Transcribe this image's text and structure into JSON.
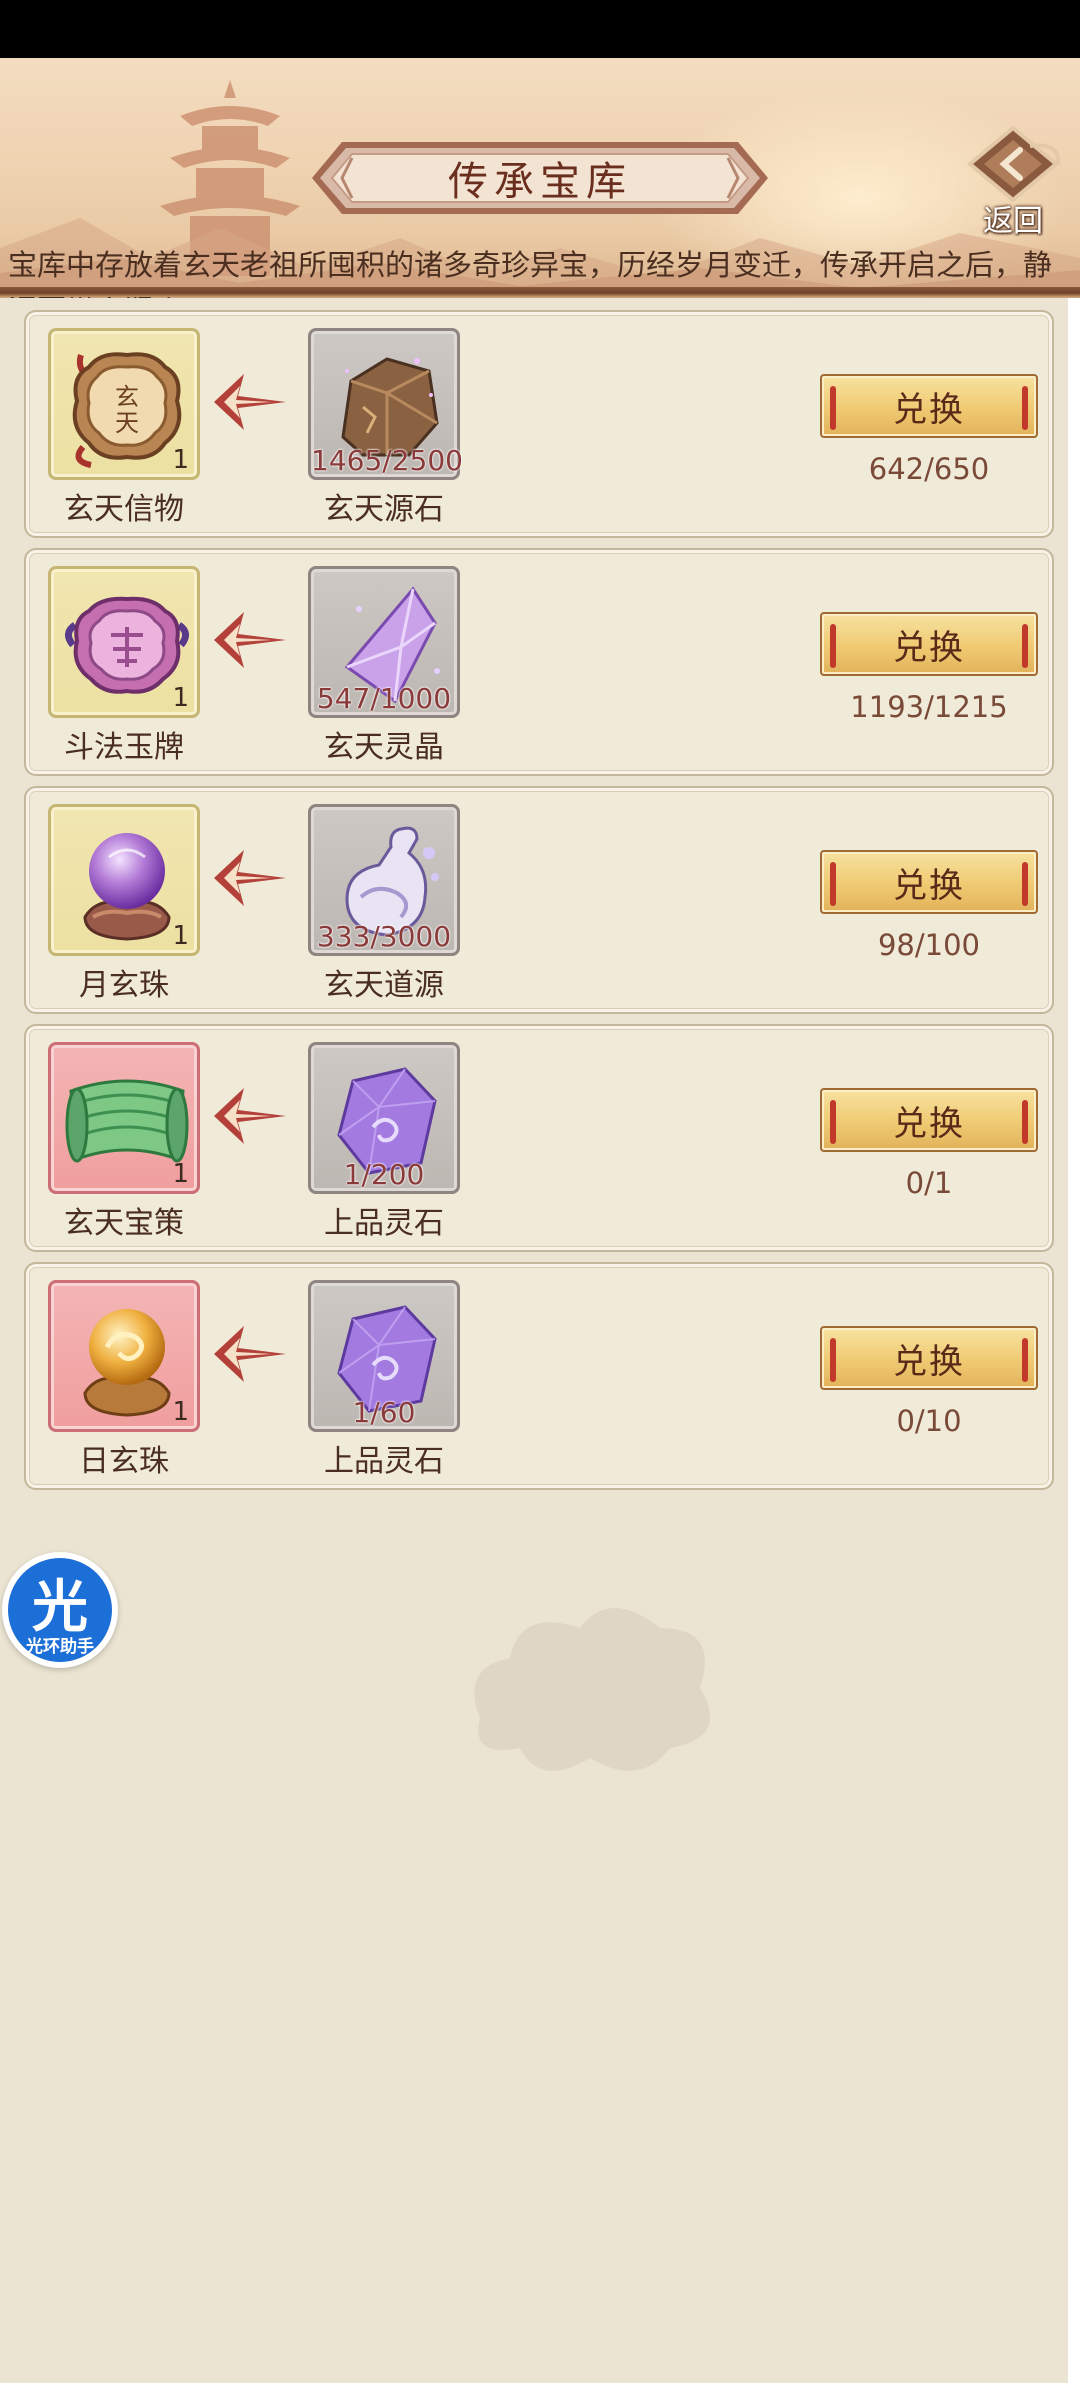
{
  "header": {
    "title": "传承宝库",
    "back_label": "返回",
    "description": "宝库中存放着玄天老祖所囤积的诸多奇珍异宝，历经岁月变迁，传承开启之后，静待有缘人取之。"
  },
  "exchange_items": [
    {
      "reward_name": "玄天信物",
      "reward_count": "1",
      "reward_icon": "token-plaque-icon",
      "reward_frame": "gold",
      "cost_name": "玄天源石",
      "cost_progress": "1465/2500",
      "cost_icon": "source-stone-icon",
      "button_label": "兑换",
      "limit": "642/650"
    },
    {
      "reward_name": "斗法玉牌",
      "reward_count": "1",
      "reward_icon": "jade-tablet-icon",
      "reward_frame": "gold",
      "cost_name": "玄天灵晶",
      "cost_progress": "547/1000",
      "cost_icon": "spirit-crystal-icon",
      "button_label": "兑换",
      "limit": "1193/1215"
    },
    {
      "reward_name": "月玄珠",
      "reward_count": "1",
      "reward_icon": "moon-pearl-icon",
      "reward_frame": "gold",
      "cost_name": "玄天道源",
      "cost_progress": "333/3000",
      "cost_icon": "dao-source-gourd-icon",
      "button_label": "兑换",
      "limit": "98/100"
    },
    {
      "reward_name": "玄天宝策",
      "reward_count": "1",
      "reward_icon": "scroll-icon",
      "reward_frame": "pink",
      "cost_name": "上品灵石",
      "cost_progress": "1/200",
      "cost_icon": "purple-spirit-stone-icon",
      "button_label": "兑换",
      "limit": "0/1"
    },
    {
      "reward_name": "日玄珠",
      "reward_count": "1",
      "reward_icon": "sun-pearl-icon",
      "reward_frame": "pink",
      "cost_name": "上品灵石",
      "cost_progress": "1/60",
      "cost_icon": "purple-spirit-stone-icon",
      "button_label": "兑换",
      "limit": "0/10"
    }
  ],
  "floating_helper": {
    "glyph": "光",
    "label": "光环助手"
  },
  "colors": {
    "title_text": "#6a2e1e",
    "button_gold": "#efca72",
    "progress_red": "#8b3a3a",
    "helper_blue": "#1d6fd8"
  }
}
